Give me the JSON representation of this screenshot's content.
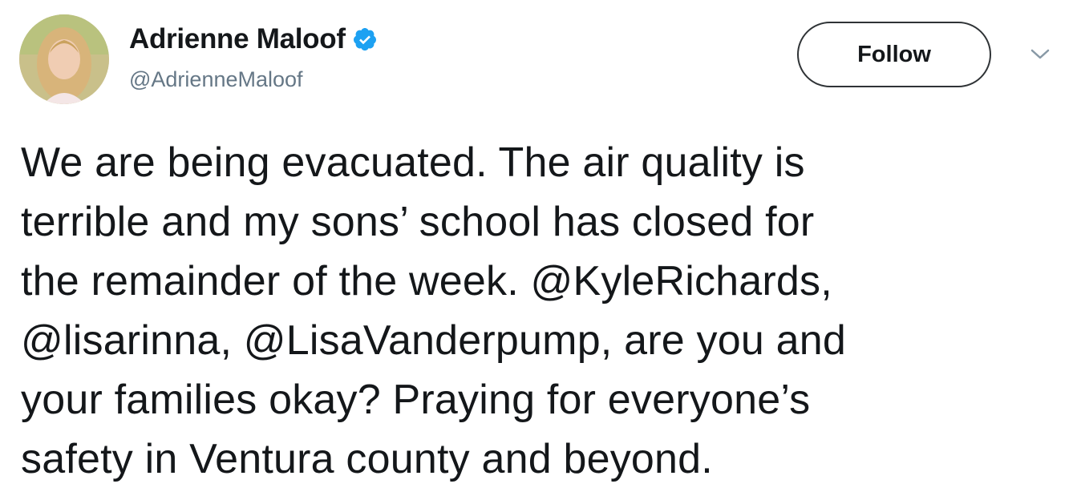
{
  "user": {
    "display_name": "Adrienne Maloof",
    "handle": "@AdrienneMaloof",
    "verified": true
  },
  "actions": {
    "follow_label": "Follow",
    "menu_icon": "chevron-down-icon"
  },
  "tweet": {
    "text": "We are being evacuated. The air quality is\nterrible and my sons’ school has closed for\nthe remainder of the week. @KyleRichards,\n@lisarinna, @LisaVanderpump, are you and\nyour families okay? Praying for everyone’s\nsafety in Ventura county and beyond."
  },
  "colors": {
    "verified_blue": "#1da1f2",
    "text_primary": "#14171a",
    "text_secondary": "#657786"
  }
}
